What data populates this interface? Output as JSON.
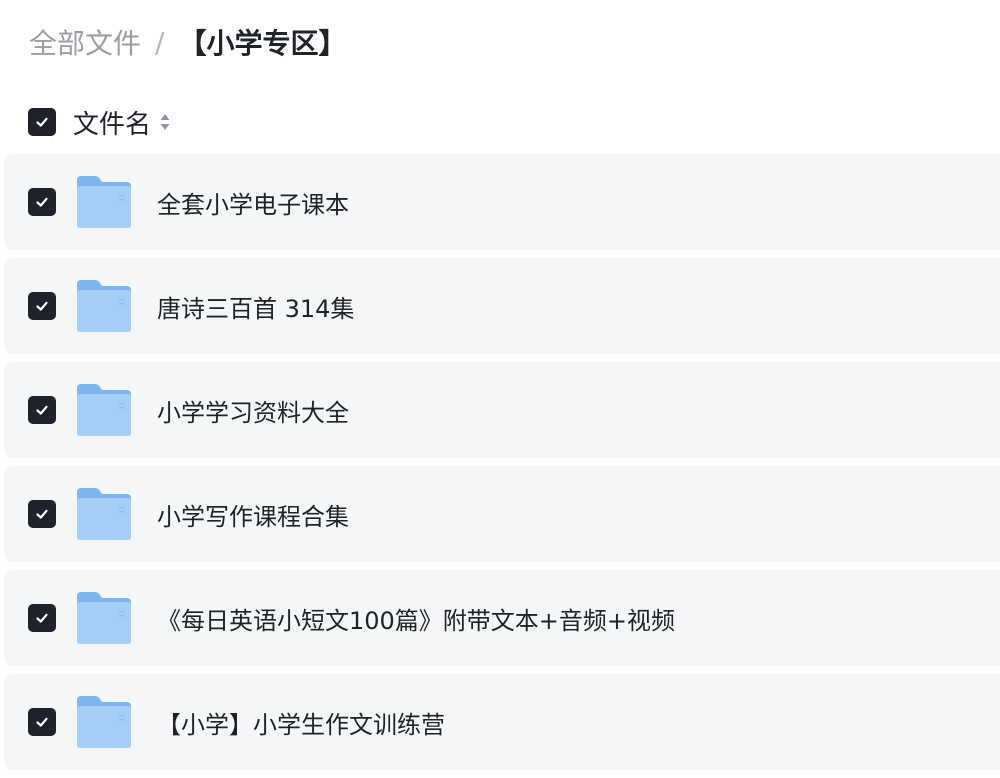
{
  "breadcrumb": {
    "root": "全部文件",
    "separator": "/",
    "current": "【小学专区】"
  },
  "table": {
    "header_label": "文件名",
    "sort_icon": "sort-updown-icon",
    "rows": [
      {
        "name": "全套小学电子课本",
        "icon": "folder-icon",
        "checked": true
      },
      {
        "name": "唐诗三百首 314集",
        "icon": "folder-icon",
        "checked": true
      },
      {
        "name": "小学学习资料大全",
        "icon": "folder-icon",
        "checked": true
      },
      {
        "name": "小学写作课程合集",
        "icon": "folder-icon",
        "checked": true
      },
      {
        "name": "《每日英语小短文100篇》附带文本+音频+视频",
        "icon": "folder-icon",
        "checked": true
      },
      {
        "name": "【小学】小学生作文训练营",
        "icon": "folder-icon",
        "checked": true
      }
    ]
  },
  "colors": {
    "checkbox": "#1f2329",
    "row_background": "#f5f6f7",
    "folder_front": "#a6cff7",
    "folder_back": "#7db7ef",
    "breadcrumb_muted": "#9b9ea3"
  }
}
